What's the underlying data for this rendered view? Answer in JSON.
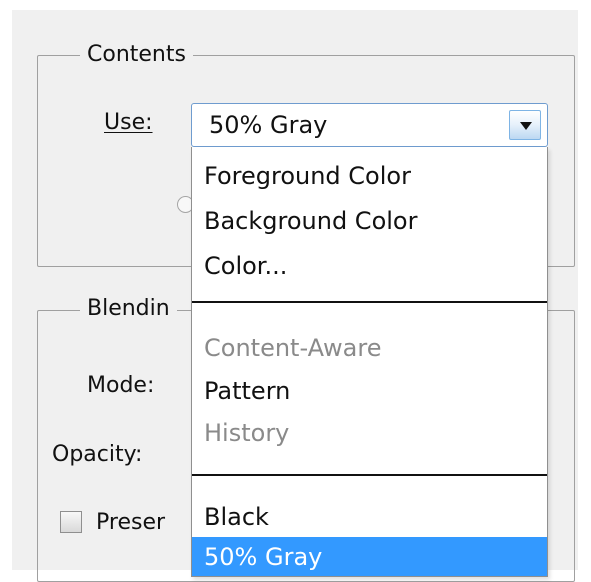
{
  "contents": {
    "legend": "Contents",
    "use_label": "Use:",
    "use_value": "50% Gray",
    "dropdown_icon": "chevron-down-icon"
  },
  "blending": {
    "legend": "Blendin",
    "mode_label": "Mode:",
    "opacity_label": "Opacity:",
    "preserve_label": "Preser"
  },
  "menu": {
    "items": [
      {
        "label": "Foreground Color",
        "enabled": true
      },
      {
        "label": "Background Color",
        "enabled": true
      },
      {
        "label": "Color...",
        "enabled": true
      },
      {
        "label": "Content-Aware",
        "enabled": false
      },
      {
        "label": "Pattern",
        "enabled": true
      },
      {
        "label": "History",
        "enabled": false
      },
      {
        "label": "Black",
        "enabled": true
      },
      {
        "label": "50% Gray",
        "enabled": true,
        "selected": true
      }
    ]
  },
  "colors": {
    "dialog_background": "#f0f0f0",
    "selection": "#3399ff",
    "disabled_text": "#8a8a8a"
  }
}
